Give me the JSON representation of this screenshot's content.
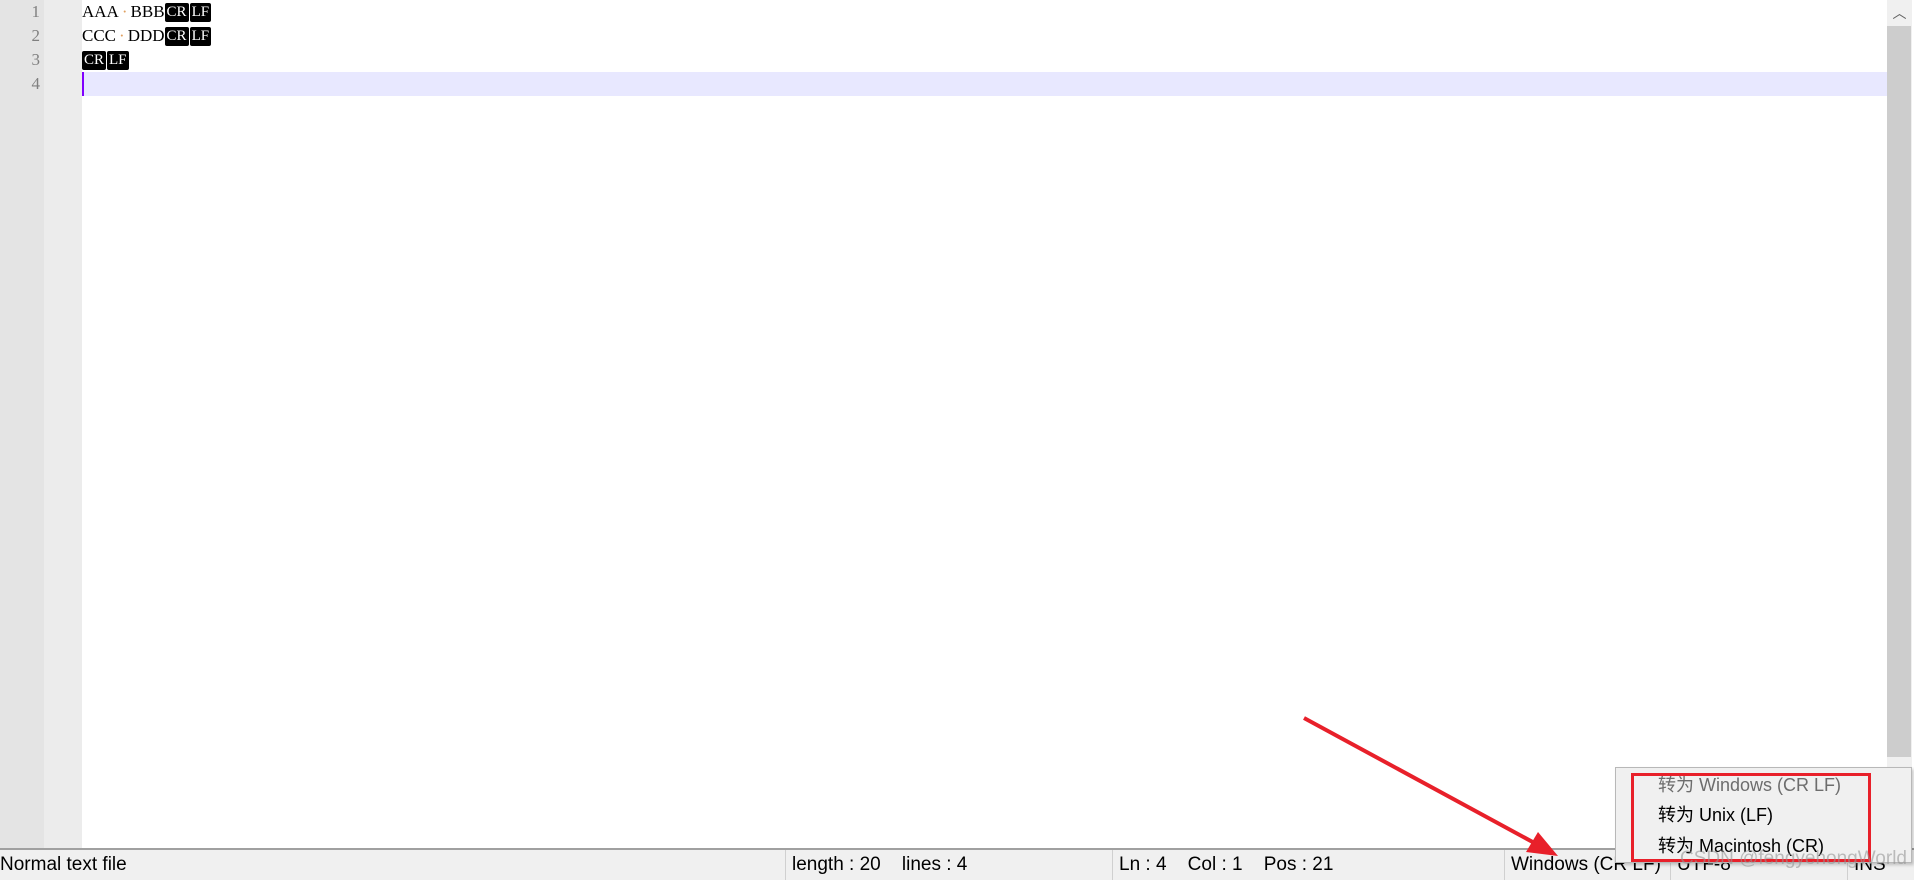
{
  "editor": {
    "line_numbers": [
      "1",
      "2",
      "3",
      "4"
    ],
    "lines": [
      {
        "parts": [
          "AAA",
          "BBB"
        ],
        "eol": [
          "CR",
          "LF"
        ]
      },
      {
        "parts": [
          "CCC",
          "DDD"
        ],
        "eol": [
          "CR",
          "LF"
        ]
      },
      {
        "parts": [],
        "eol": [
          "CR",
          "LF"
        ]
      },
      {
        "parts": [],
        "eol": []
      }
    ],
    "space_marker": "·"
  },
  "status": {
    "file_type": "Normal text file",
    "length": "length : 20",
    "lines": "lines : 4",
    "ln": "Ln : 4",
    "col": "Col : 1",
    "pos": "Pos : 21",
    "eol_format": "Windows (CR LF)",
    "encoding": "UTF-8",
    "mode": "INS"
  },
  "context_menu": {
    "items": [
      {
        "label": "转为 Windows (CR LF)",
        "disabled": true
      },
      {
        "label": "转为 Unix (LF)",
        "disabled": false
      },
      {
        "label": "转为 Macintosh (CR)",
        "disabled": false
      }
    ]
  },
  "annotation": {
    "color": "#e8202a"
  },
  "watermark": "CSDN @fengyehongWorld",
  "scrollbar": {
    "up_icon": "chevron-up-icon"
  }
}
